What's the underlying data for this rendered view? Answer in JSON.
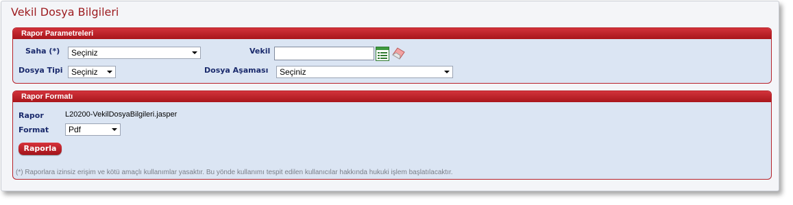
{
  "page": {
    "title": "Vekil Dosya Bilgileri"
  },
  "params_panel": {
    "title": "Rapor Parametreleri",
    "saha_label": "Saha (*)",
    "saha_value": "Seçiniz",
    "vekil_label": "Vekil",
    "vekil_value": "",
    "dosya_tipi_label": "Dosya Tipi",
    "dosya_tipi_value": "Seçiniz",
    "dosya_asamasi_label": "Dosya Aşaması",
    "dosya_asamasi_value": "Seçiniz"
  },
  "format_panel": {
    "title": "Rapor Formatı",
    "rapor_label": "Rapor",
    "rapor_value": "L20200-VekilDosyaBilgileri.jasper",
    "format_label": "Format",
    "format_value": "Pdf",
    "button_label": "Raporla",
    "note": "(*) Raporlara izinsiz erişim ve kötü amaçlı kullanımlar yasaktır. Bu yönde kullanımı tespit edilen kullanıcılar hakkında hukuki işlem başlatılacaktır."
  },
  "icons": {
    "lookup": "list-lookup-icon",
    "clear": "eraser-icon"
  },
  "colors": {
    "accent": "#b61f27",
    "panel_bg": "#dbe5f3",
    "label_text": "#1a2a6c",
    "title_text": "#9c1a1e"
  }
}
